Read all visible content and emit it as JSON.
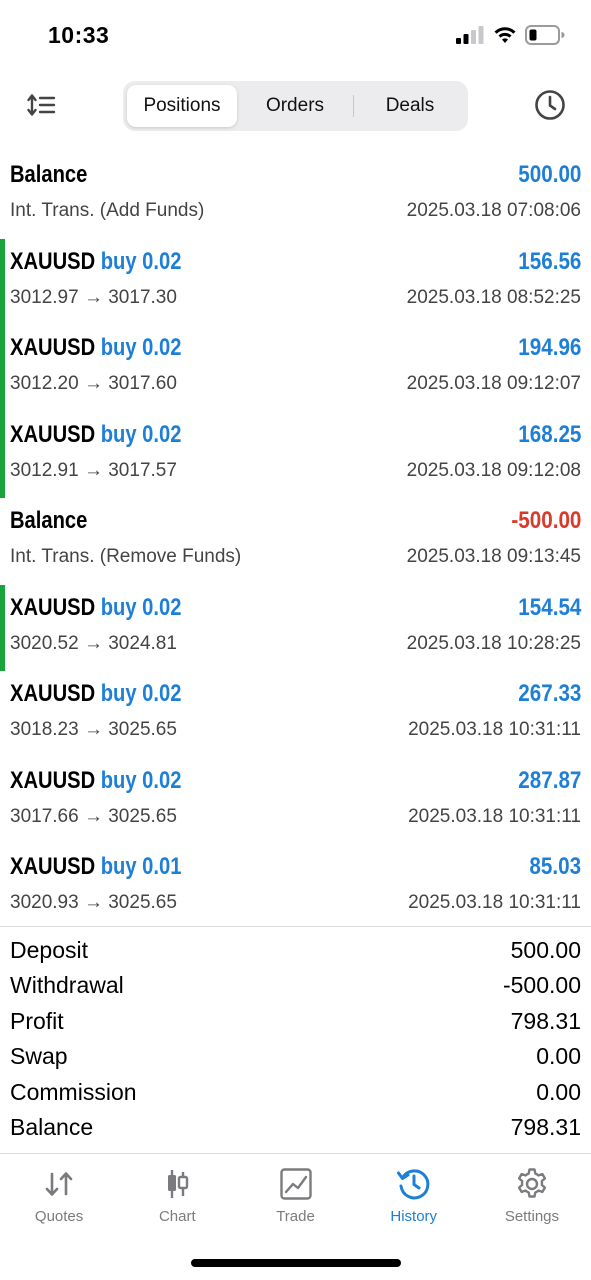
{
  "status": {
    "time": "10:33"
  },
  "segments": [
    {
      "label": "Positions",
      "active": true
    },
    {
      "label": "Orders",
      "active": false
    },
    {
      "label": "Deals",
      "active": false
    }
  ],
  "icons": {
    "sort": "sort-icon",
    "history_clock": "clock-icon"
  },
  "colors": {
    "accent": "#1e7fd6",
    "negative": "#d93a2b",
    "buy_bar": "#1aa33a"
  },
  "deals": [
    {
      "symbol": "Balance",
      "direction": "",
      "amount": "500.00",
      "sub": "Int. Trans. (Add Funds)",
      "date": "2025.03.18 07:08:06",
      "negative": false,
      "bar": false
    },
    {
      "symbol": "XAUUSD",
      "direction": "buy 0.02",
      "amount": "156.56",
      "sub": "3012.97 → 3017.30",
      "date": "2025.03.18 08:52:25",
      "negative": false,
      "bar": true
    },
    {
      "symbol": "XAUUSD",
      "direction": "buy 0.02",
      "amount": "194.96",
      "sub": "3012.20 → 3017.60",
      "date": "2025.03.18 09:12:07",
      "negative": false,
      "bar": true
    },
    {
      "symbol": "XAUUSD",
      "direction": "buy 0.02",
      "amount": "168.25",
      "sub": "3012.91 → 3017.57",
      "date": "2025.03.18 09:12:08",
      "negative": false,
      "bar": true
    },
    {
      "symbol": "Balance",
      "direction": "",
      "amount": "-500.00",
      "sub": "Int. Trans. (Remove Funds)",
      "date": "2025.03.18 09:13:45",
      "negative": true,
      "bar": false
    },
    {
      "symbol": "XAUUSD",
      "direction": "buy 0.02",
      "amount": "154.54",
      "sub": "3020.52 → 3024.81",
      "date": "2025.03.18 10:28:25",
      "negative": false,
      "bar": true
    },
    {
      "symbol": "XAUUSD",
      "direction": "buy 0.02",
      "amount": "267.33",
      "sub": "3018.23 → 3025.65",
      "date": "2025.03.18 10:31:11",
      "negative": false,
      "bar": false
    },
    {
      "symbol": "XAUUSD",
      "direction": "buy 0.02",
      "amount": "287.87",
      "sub": "3017.66 → 3025.65",
      "date": "2025.03.18 10:31:11",
      "negative": false,
      "bar": false
    },
    {
      "symbol": "XAUUSD",
      "direction": "buy 0.01",
      "amount": "85.03",
      "sub": "3020.93 → 3025.65",
      "date": "2025.03.18 10:31:11",
      "negative": false,
      "bar": false
    }
  ],
  "summary": [
    {
      "label": "Deposit",
      "value": "500.00"
    },
    {
      "label": "Withdrawal",
      "value": "-500.00"
    },
    {
      "label": "Profit",
      "value": "798.31"
    },
    {
      "label": "Swap",
      "value": "0.00"
    },
    {
      "label": "Commission",
      "value": "0.00"
    },
    {
      "label": "Balance",
      "value": "798.31"
    }
  ],
  "tabs": [
    {
      "label": "Quotes",
      "icon": "quotes-icon",
      "active": false
    },
    {
      "label": "Chart",
      "icon": "chart-icon",
      "active": false
    },
    {
      "label": "Trade",
      "icon": "trade-icon",
      "active": false
    },
    {
      "label": "History",
      "icon": "history-icon",
      "active": true
    },
    {
      "label": "Settings",
      "icon": "gear-icon",
      "active": false
    }
  ]
}
